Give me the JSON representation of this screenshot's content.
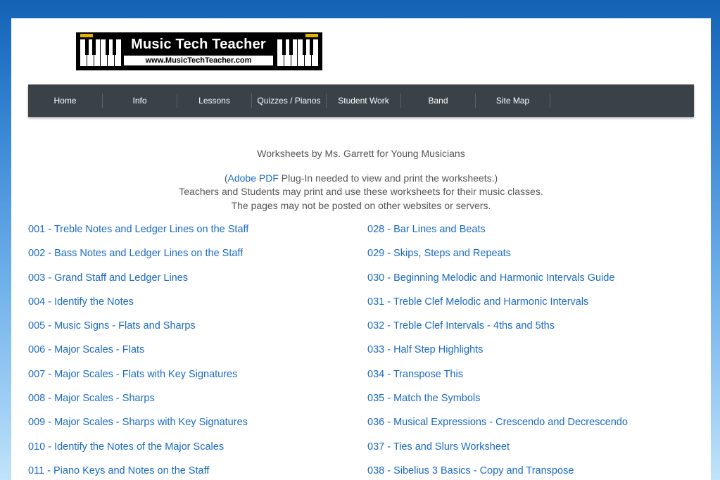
{
  "logo": {
    "title": "Music Tech Teacher",
    "url": "www.MusicTechTeacher.com"
  },
  "nav": {
    "items": [
      "Home",
      "Info",
      "Lessons",
      "Quizzes / Pianos",
      "Student Work",
      "Band",
      "Site Map"
    ]
  },
  "intro": {
    "heading": "Worksheets by Ms. Garrett for Young Musicians",
    "paren_open": "(",
    "pdf_link": "Adobe PDF",
    "plugin_text": " Plug-In needed to view and print the worksheets.)",
    "line2": "Teachers and Students may print and use these worksheets for their music classes.",
    "line3": "The pages may not be posted on other websites or servers."
  },
  "worksheets_left": [
    "001 - Treble Notes and Ledger Lines on the Staff",
    "002 - Bass Notes and Ledger Lines on the Staff",
    "003 - Grand Staff and Ledger Lines",
    "004 - Identify the Notes",
    "005 - Music Signs - Flats and Sharps",
    "006 - Major Scales - Flats",
    "007 - Major Scales - Flats with Key Signatures",
    "008 - Major Scales - Sharps",
    "009 - Major Scales - Sharps with Key Signatures",
    "010 - Identify the Notes of the Major Scales",
    "011 - Piano Keys and Notes on the Staff"
  ],
  "worksheets_right": [
    "028 - Bar Lines and Beats",
    "029 - Skips, Steps and Repeats",
    "030 - Beginning Melodic and Harmonic Intervals Guide",
    "031 - Treble Clef Melodic and Harmonic Intervals",
    "032 - Treble Clef Intervals - 4ths and 5ths",
    "033 - Half Step Highlights",
    "034 - Transpose This",
    "035 - Match the Symbols",
    "036 - Musical Expressions - Crescendo and Decrescendo",
    "037 - Ties and Slurs Worksheet",
    "038 - Sibelius 3 Basics - Copy and Transpose"
  ],
  "colors": {
    "link": "#1a6ac2",
    "nav_bg": "#3b4247",
    "text": "#555555"
  }
}
